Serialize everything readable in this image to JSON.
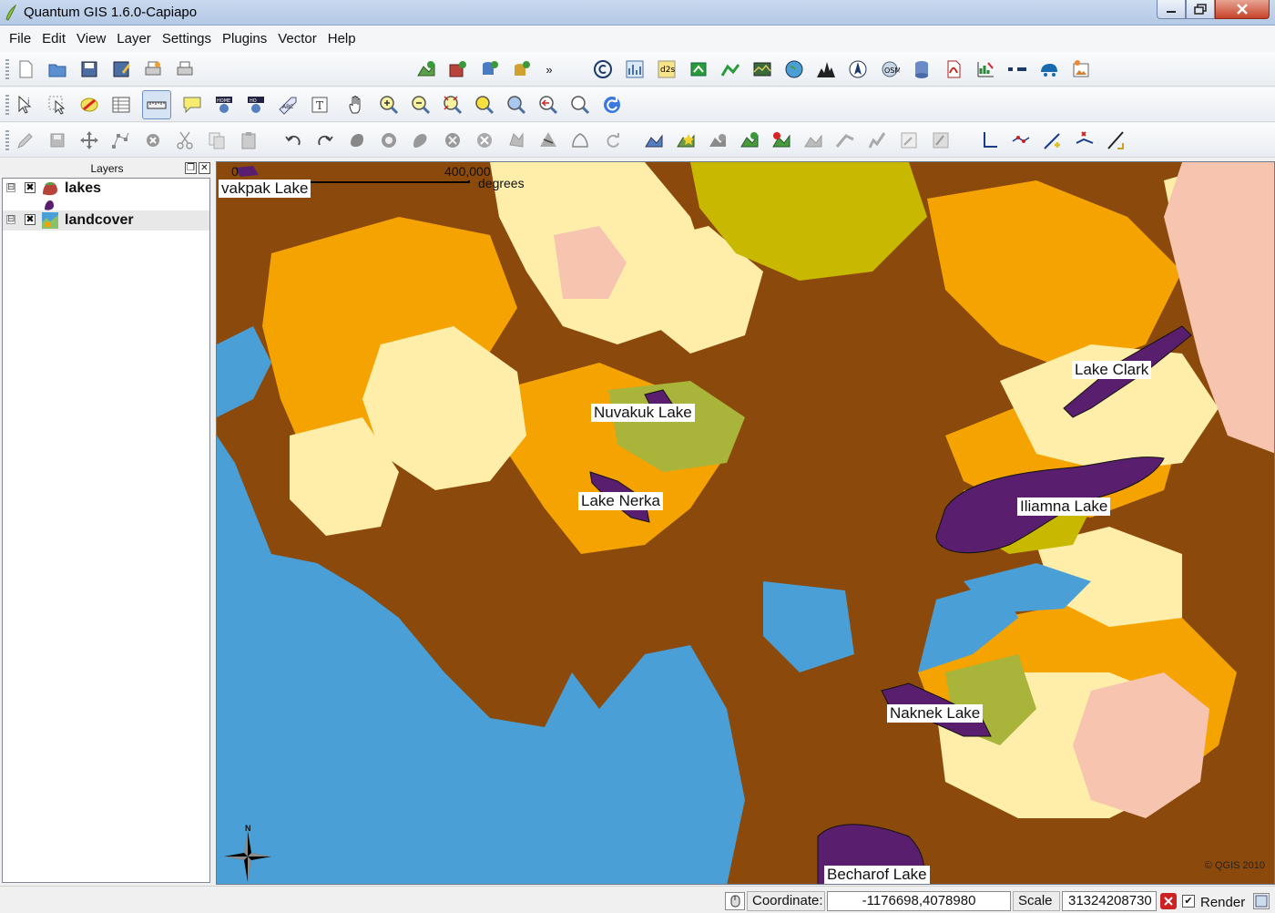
{
  "window": {
    "title": "Quantum GIS 1.6.0-Capiapo"
  },
  "menu": [
    "File",
    "Edit",
    "View",
    "Layer",
    "Settings",
    "Plugins",
    "Vector",
    "Help"
  ],
  "toolbar_overflow": "»",
  "layers_panel": {
    "title": "Layers",
    "layers": [
      {
        "name": "lakes",
        "checked": "✖",
        "expanded": "⊟"
      },
      {
        "name": "landcover",
        "checked": "✖",
        "expanded": "⊟"
      }
    ]
  },
  "map": {
    "scalebar": {
      "start": "0",
      "end": "400,000",
      "unit": "degrees"
    },
    "lake_labels": [
      "vakpak Lake",
      "Nuvakuk Lake",
      "Lake Nerka",
      "Lake Clark",
      "Iliamna Lake",
      "Naknek Lake",
      "Becharof Lake"
    ],
    "north": "N",
    "copyright": "© QGIS 2010"
  },
  "status": {
    "coordinate_label": "Coordinate:",
    "coordinate_value": "-1176698,4078980",
    "scale_label": "Scale",
    "scale_value": "31324208730",
    "render_label": "Render"
  },
  "colors": {
    "water": "#4a9fd6",
    "forest": "#8b4a0c",
    "shrub": "#f5a300",
    "tundra": "#ffeeaa",
    "grass": "#c8b800",
    "lake_fill": "#5a1e6e",
    "barren": "#f7c4b0"
  }
}
